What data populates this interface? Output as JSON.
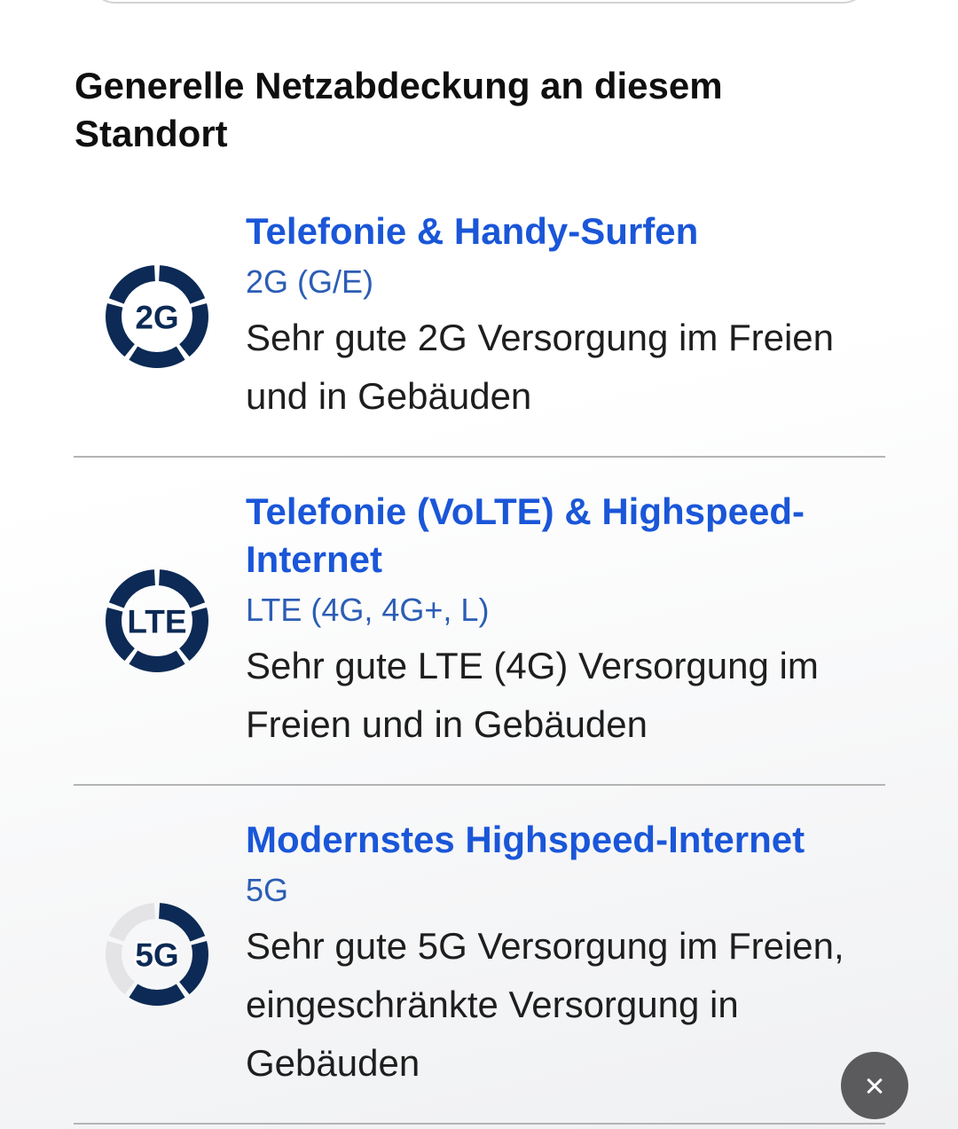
{
  "heading": "Generelle Netzabdeckung an diesem Standort",
  "colors": {
    "navy": "#0c2a55",
    "title_blue": "#1a56d8",
    "subtitle_blue": "#2c5db5",
    "text": "#1e1e1e",
    "divider": "#b4b4b4",
    "segment_empty": "#e4e4e6",
    "close_bg": "#5b5b5d"
  },
  "coverage": [
    {
      "icon": "signal-ring-icon",
      "icon_label": "2G",
      "title": "Telefonie & Handy-Surfen",
      "technology": "2G (G/E)",
      "description": "Sehr gute 2G Versorgung im Freien und in Gebäuden",
      "signal": {
        "level": 5,
        "max": 5
      }
    },
    {
      "icon": "signal-ring-icon",
      "icon_label": "LTE",
      "title": "Telefonie (VoLTE) & Highspeed-Internet",
      "technology": "LTE (4G, 4G+, L)",
      "description": "Sehr gute LTE (4G) Versorgung im Freien und in Gebäuden",
      "signal": {
        "level": 5,
        "max": 5
      }
    },
    {
      "icon": "signal-ring-icon",
      "icon_label": "5G",
      "title": "Modernstes Highspeed-Internet",
      "technology": "5G",
      "description": "Sehr gute 5G Versorgung im Freien, eingeschränkte Versorgung in Gebäuden",
      "signal": {
        "level": 3,
        "max": 5
      }
    }
  ],
  "close_button": {
    "icon": "close-icon"
  }
}
